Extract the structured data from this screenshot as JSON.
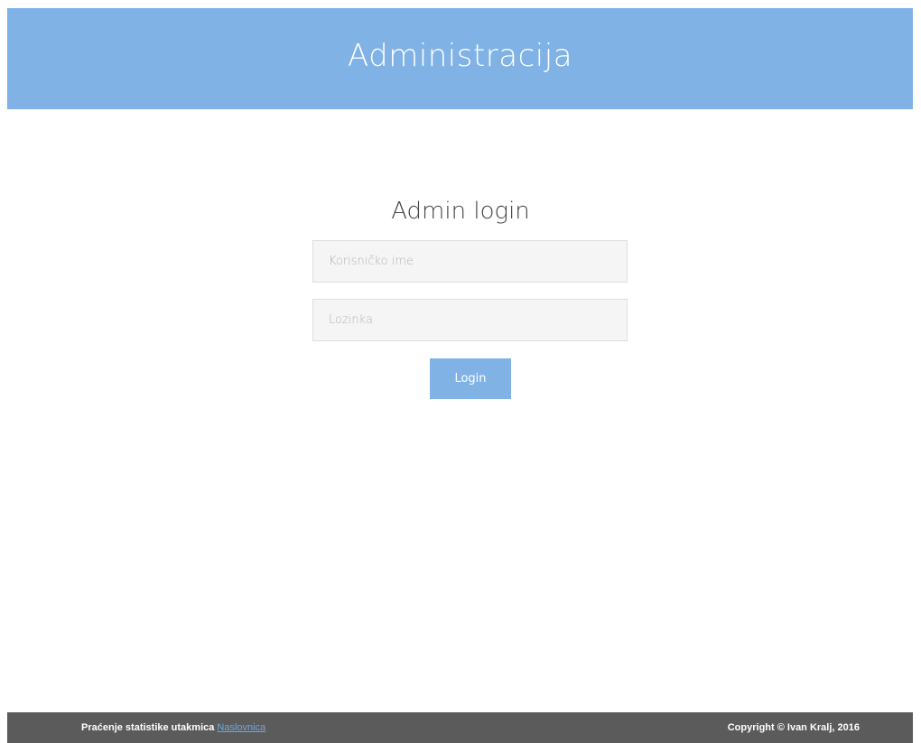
{
  "header": {
    "title": "Administracija"
  },
  "login": {
    "title": "Admin login",
    "username_placeholder": "Korisničko ime",
    "password_placeholder": "Lozinka",
    "button_label": "Login"
  },
  "footer": {
    "left_text": "Praćenje statistike utakmica",
    "link_text": "Naslovnica",
    "copyright": "Copyright © Ivan Kralj, 2016"
  },
  "colors": {
    "accent": "#80b2e6",
    "footer_bg": "#5b5b5b",
    "link": "#6ea6e8"
  }
}
